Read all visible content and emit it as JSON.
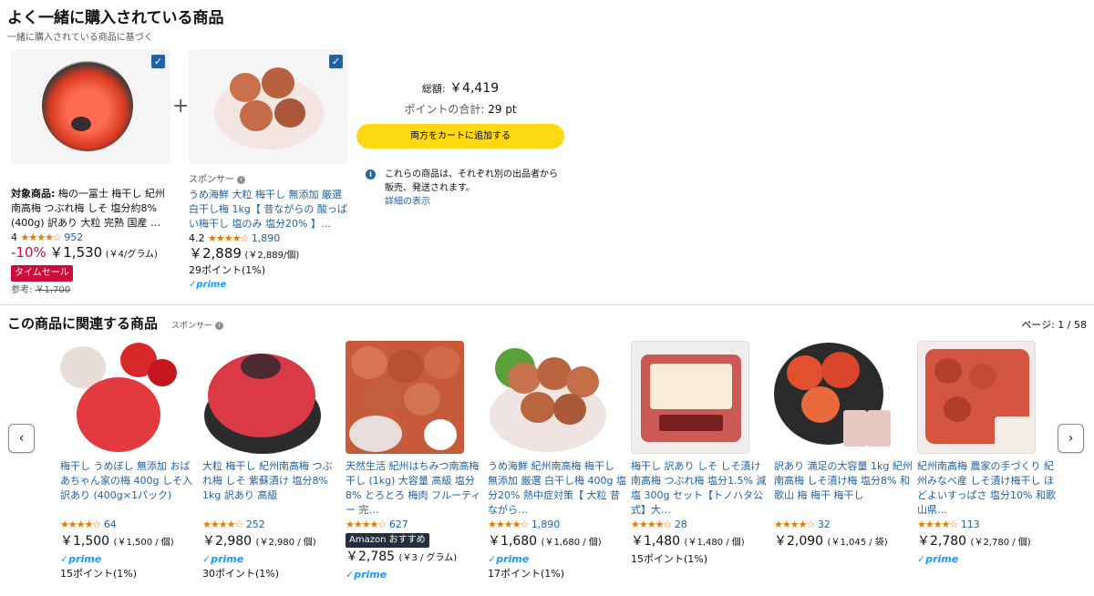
{
  "fbt": {
    "title": "よく一緒に購入されている商品",
    "subtitle": "一緒に購入されている商品に基づく",
    "plus": "+",
    "items": [
      {
        "target_label": "対象商品:",
        "title": "梅の一冨士 梅干し 紀州南高梅 つぶれ梅 しそ 塩分約8% (400g) 訳あり 大粒 完熟 国産 …",
        "rating": "4",
        "stars": "★★★★☆",
        "reviews": "952",
        "discount": "-10%",
        "price": "￥1,530",
        "unit_price": "(￥4/グラム)",
        "deal": "タイムセール",
        "ref_label": "参考:",
        "ref_price": "￥1,700"
      },
      {
        "sponsor": "スポンサー",
        "title": "うめ海鮮 大粒 梅干し 無添加 厳選 白干し梅 1kg【 昔ながらの 酸っぱい梅干し 塩のみ 塩分20% 】…",
        "rating": "4.2",
        "stars": "★★★★☆",
        "reviews": "1,890",
        "price": "￥2,889",
        "unit_price": "(￥2,889/個)",
        "points": "29ポイント(1%)",
        "prime": "✓prime"
      }
    ],
    "total_label": "総額:",
    "total": "￥4,419",
    "points_label": "ポイントの合計:",
    "points": "29 pt",
    "cart_button": "両方をカートに追加する",
    "seller_note": "これらの商品は、それぞれ別の出品者から販売、発送されます。",
    "details_link": "詳細の表示"
  },
  "related": {
    "title": "この商品に関連する商品",
    "sponsor": "スポンサー",
    "page": "ページ: 1 / 58",
    "prev": "‹",
    "next": "›",
    "items": [
      {
        "title": "梅干し うめぼし 無添加 おばあちゃん家の梅 400g しそ入 訳あり (400g×1パック)",
        "stars": "★★★★☆",
        "reviews": "64",
        "price": "￥1,500",
        "unit": "(￥1,500 / 個)",
        "prime": "✓prime",
        "points": "15ポイント(1%)"
      },
      {
        "title": "大粒 梅干し 紀州南高梅 つぶれ梅 しそ 紫蘇漬け 塩分8% 1kg 訳あり 高級",
        "stars": "★★★★☆",
        "reviews": "252",
        "price": "￥2,980",
        "unit": "(￥2,980 / 個)",
        "prime": "✓prime",
        "points": "30ポイント(1%)"
      },
      {
        "title": "天然生活 紀州はちみつ南高梅干し (1kg) 大容量 高級 塩分8% とろとろ 梅肉 フルーティー 完…",
        "stars": "★★★★☆",
        "reviews": "627",
        "badge": "Amazon おすすめ",
        "price": "￥2,785",
        "unit": "(￥3 / グラム)",
        "prime": "✓prime"
      },
      {
        "title": "うめ海鮮 紀州南高梅 梅干し 無添加 厳選 白干し梅 400g 塩分20% 熱中症対策【 大粒 昔ながら…",
        "stars": "★★★★☆",
        "reviews": "1,890",
        "price": "￥1,680",
        "unit": "(￥1,680 / 個)",
        "prime": "✓prime",
        "points": "17ポイント(1%)"
      },
      {
        "title": "梅干し 訳あり しそ しそ漬け 南高梅 つぶれ梅 塩分1.5% 減塩 300g セット【トノハタ公式】大…",
        "stars": "★★★★☆",
        "reviews": "28",
        "price": "￥1,480",
        "unit": "(￥1,480 / 個)",
        "points": "15ポイント(1%)"
      },
      {
        "title": "訳あり 満足の大容量 1kg 紀州南高梅 しそ漬け梅 塩分8% 和歌山 梅 梅干 梅干し",
        "stars": "★★★★☆",
        "reviews": "32",
        "price": "￥2,090",
        "unit": "(￥1,045 / 袋)"
      },
      {
        "title": "紀州南高梅 農家の手づくり 紀州みなべ産 しそ漬け梅干し ほどよいすっぱさ 塩分10% 和歌山県…",
        "stars": "★★★★☆",
        "reviews": "113",
        "price": "￥2,780",
        "unit": "(￥2,780 / 個)",
        "prime": "✓prime"
      }
    ]
  }
}
